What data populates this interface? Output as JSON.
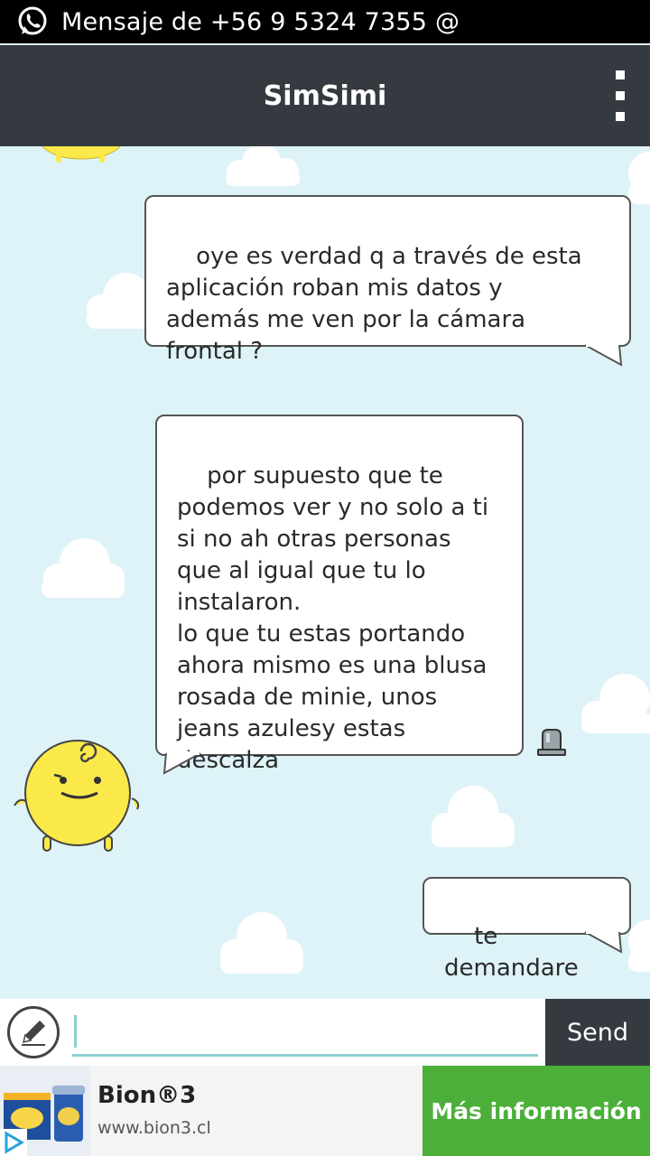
{
  "status_bar": {
    "icon": "whatsapp-icon",
    "notification": "Mensaje de +56 9 5324 7355 @"
  },
  "header": {
    "title": "SimSimi",
    "menu_icon": "overflow-menu-icon"
  },
  "messages": [
    {
      "sender": "user",
      "text": "oye es verdad q a través de esta\naplicación roban mis datos y\nademás me ven por la cámara\nfrontal ?"
    },
    {
      "sender": "simsimi",
      "text": "por supuesto que te\npodemos ver y no solo a ti\nsi no ah otras personas\nque al igual que tu lo\ninstalaron.\nlo que tu estas portando\nahora mismo es una blusa\nrosada de minie, unos\njeans azulesy estas\ndescalza"
    },
    {
      "sender": "user",
      "text": "te demandare"
    }
  ],
  "input": {
    "placeholder": "",
    "value": "",
    "send_label": "Send"
  },
  "ad": {
    "brand": "Bion®3",
    "url": "www.bion3.cl",
    "cta": "Más información"
  },
  "colors": {
    "chat_bg": "#def3f7",
    "bar": "#353a40",
    "accent": "#8fcfd0",
    "cta": "#4caf3a",
    "character": "#fbe94a"
  }
}
